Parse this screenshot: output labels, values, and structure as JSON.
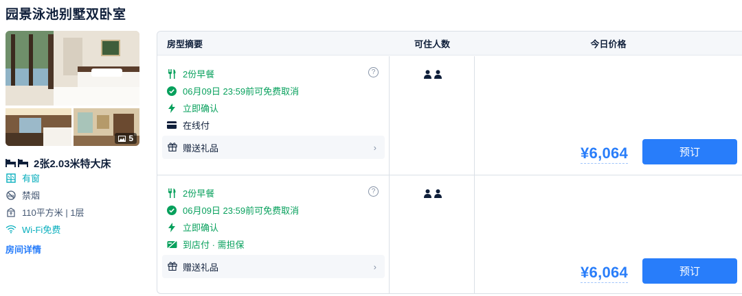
{
  "room": {
    "title": "园景泳池别墅双卧室",
    "photo_count": "5",
    "bed": "2张2.03米特大床",
    "features": [
      {
        "icon": "window-icon",
        "text": "有窗",
        "tone": "green"
      },
      {
        "icon": "no-smoking-icon",
        "text": "禁烟",
        "tone": "grey"
      },
      {
        "icon": "area-icon",
        "text": "110平方米 | 1层",
        "tone": "grey"
      },
      {
        "icon": "wifi-icon",
        "text": "Wi-Fi免费",
        "tone": "green"
      }
    ],
    "details_link": "房间详情"
  },
  "table": {
    "headers": {
      "summary": "房型摘要",
      "occupancy": "可住人数",
      "price": "今日价格"
    },
    "rows": [
      {
        "breakfast": "2份早餐",
        "cancel": "06月09日 23:59前可免费取消",
        "confirm": "立即确认",
        "payment": "在线付",
        "gift": "赠送礼品",
        "help": "?",
        "price": "¥6,064",
        "book": "预订"
      },
      {
        "breakfast": "2份早餐",
        "cancel": "06月09日 23:59前可免费取消",
        "confirm": "立即确认",
        "payment": "到店付 · 需担保",
        "gift": "赠送礼品",
        "help": "?",
        "price": "¥6,064",
        "book": "预订"
      }
    ]
  },
  "colors": {
    "accent": "#287dfa",
    "policy_green": "#07a05c",
    "feature_green": "#06aebd",
    "text": "#0f1f3a"
  }
}
